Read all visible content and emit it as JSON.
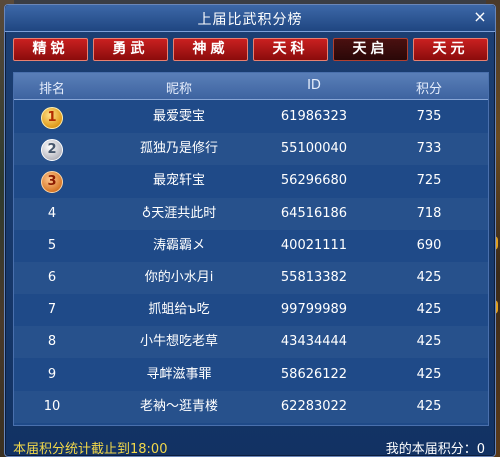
{
  "window": {
    "title": "上届比武积分榜",
    "close_label": "×"
  },
  "tabs": [
    {
      "label": "精锐"
    },
    {
      "label": "勇武"
    },
    {
      "label": "神威"
    },
    {
      "label": "天科"
    },
    {
      "label": "天启",
      "active": true
    },
    {
      "label": "天元"
    }
  ],
  "table": {
    "headers": {
      "rank": "排名",
      "name": "昵称",
      "id": "ID",
      "score": "积分"
    },
    "rows": [
      {
        "rank": "1",
        "name": "最爱雯宝",
        "id": "61986323",
        "score": "735"
      },
      {
        "rank": "2",
        "name": "孤独乃是修行",
        "id": "55100040",
        "score": "733"
      },
      {
        "rank": "3",
        "name": "最宠轩宝",
        "id": "56296680",
        "score": "725"
      },
      {
        "rank": "4",
        "name": "♁天涯共此时",
        "id": "64516186",
        "score": "718"
      },
      {
        "rank": "5",
        "name": "涛霸霸メ",
        "id": "40021111",
        "score": "690"
      },
      {
        "rank": "6",
        "name": "你的小水月i",
        "id": "55813382",
        "score": "425"
      },
      {
        "rank": "7",
        "name": "抓蛆给ъ吃",
        "id": "99799989",
        "score": "425"
      },
      {
        "rank": "8",
        "name": "小牛想吃老草",
        "id": "43434444",
        "score": "425"
      },
      {
        "rank": "9",
        "name": "寻衅滋事罪",
        "id": "58626122",
        "score": "425"
      },
      {
        "rank": "10",
        "name": "老衲～逛青楼",
        "id": "62283022",
        "score": "425"
      }
    ]
  },
  "footer": {
    "deadline_text": "本届积分统计截止到18:00",
    "my_score_text": "我的本届积分：0"
  },
  "colors": {
    "panel": "#1c3f73",
    "tab": "#c92020",
    "tab_active": "#3a0c0c",
    "footer_highlight": "#f2d84a"
  }
}
